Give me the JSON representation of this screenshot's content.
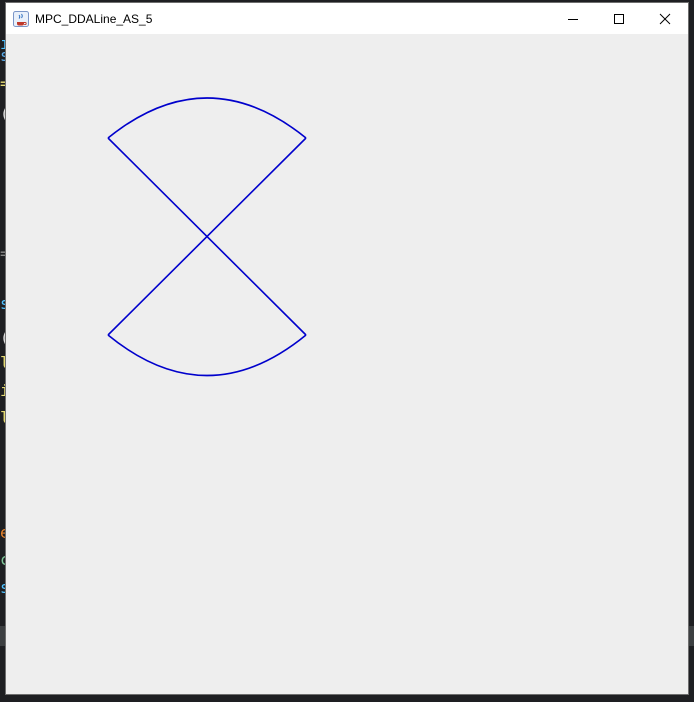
{
  "window": {
    "title": "MPC_DDALine_AS_5",
    "controls": {
      "minimize": "minimize",
      "maximize": "maximize",
      "close": "close"
    }
  },
  "colors": {
    "canvas_bg": "#eeeeee",
    "stroke": "#0000cc",
    "titlebar_bg": "#ffffff"
  },
  "drawing": {
    "description_shapes": [
      "line-top-left-to-bottom-right",
      "line-top-right-to-bottom-left",
      "arc-top",
      "arc-bottom"
    ]
  }
}
